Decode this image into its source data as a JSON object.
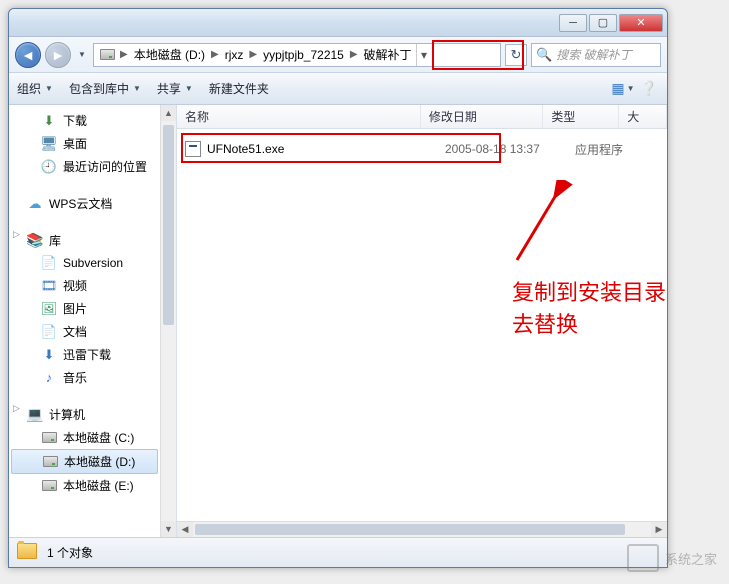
{
  "breadcrumb": {
    "segments": [
      "本地磁盘 (D:)",
      "rjxz",
      "yypjtpjb_72215",
      "破解补丁"
    ]
  },
  "search": {
    "placeholder": "搜索 破解补丁"
  },
  "toolbar": {
    "organize": "组织",
    "include": "包含到库中",
    "share": "共享",
    "newfolder": "新建文件夹"
  },
  "columns": {
    "name": "名称",
    "date": "修改日期",
    "type": "类型",
    "size": "大"
  },
  "files": [
    {
      "name": "UFNote51.exe",
      "date": "2005-08-18 13:37",
      "type": "应用程序"
    }
  ],
  "sidebar": {
    "downloads": "下载",
    "desktop": "桌面",
    "recent": "最近访问的位置",
    "wps": "WPS云文档",
    "libraries": "库",
    "subversion": "Subversion",
    "videos": "视频",
    "pictures": "图片",
    "documents": "文档",
    "xunlei": "迅雷下载",
    "music": "音乐",
    "computer": "计算机",
    "drive_c": "本地磁盘 (C:)",
    "drive_d": "本地磁盘 (D:)",
    "drive_e": "本地磁盘 (E:)"
  },
  "status": {
    "count": "1 个对象"
  },
  "annotation": {
    "text": "复制到安装目录去替换"
  },
  "watermark": {
    "text": "系统之家"
  }
}
